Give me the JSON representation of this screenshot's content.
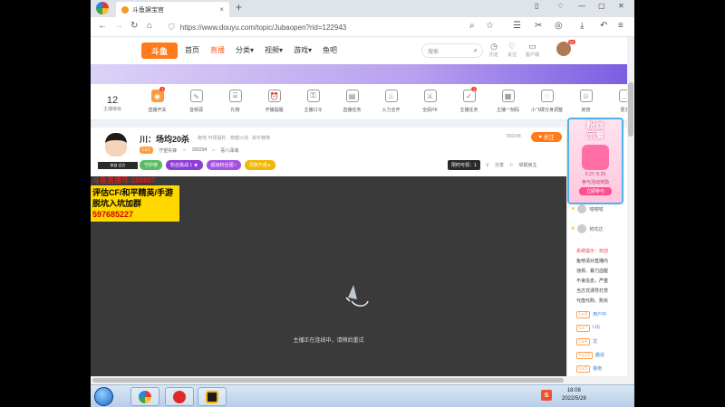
{
  "browser": {
    "tab_title": "斗鱼娱宝官",
    "url": "https://www.douyu.com/topic/Jubaopen?rid=122943"
  },
  "site": {
    "logo": "斗鱼",
    "nav": [
      "首页",
      "直播",
      "分类▾",
      "视频▾",
      "游戏▾",
      "鱼吧"
    ],
    "search_placeholder": "搜索",
    "header_icons": [
      "历史",
      "关注",
      "客户端"
    ],
    "avatar_badge": "99"
  },
  "funcbar": {
    "level": "12",
    "level_label": "主播等级",
    "items": [
      {
        "label": "直播开关",
        "icon": "broadcast-icon",
        "badge": "1"
      },
      {
        "label": "音频源",
        "icon": "audio-icon",
        "badge": ""
      },
      {
        "label": "礼物",
        "icon": "gift-icon",
        "badge": ""
      },
      {
        "label": "开播提醒",
        "icon": "alarm-icon",
        "badge": ""
      },
      {
        "label": "主播口令",
        "icon": "key-icon",
        "badge": ""
      },
      {
        "label": "直播任务",
        "icon": "task-icon",
        "badge": ""
      },
      {
        "label": "火力全开",
        "icon": "fire-icon",
        "badge": ""
      },
      {
        "label": "全民PK",
        "icon": "pk-icon",
        "badge": ""
      },
      {
        "label": "主播任务",
        "icon": "mission-icon",
        "badge": "1"
      },
      {
        "label": "主播一刻码",
        "icon": "code-icon",
        "badge": ""
      },
      {
        "label": "小飞碟分身调整",
        "icon": "ufo-icon",
        "badge": ""
      },
      {
        "label": "房管",
        "icon": "admin-icon",
        "badge": ""
      },
      {
        "label": "更多",
        "icon": "more-icon",
        "badge": ""
      }
    ]
  },
  "room": {
    "anchor_name": "来自 远方",
    "title": "川：场均20杀",
    "title_tags": "绝地 可领福利 · 穿越火线 · 和平精英",
    "category": "守望先锋",
    "level_pill": "Lv.1",
    "fans": "150294",
    "location": "喜八泽城",
    "followers": "780248",
    "follow_label": "关注",
    "badges": [
      {
        "text": "守护榜",
        "color": "#5bbb62"
      },
      {
        "text": "粉丝挑战 1 ★",
        "color": "#8b3dd6"
      },
      {
        "text": "超级粉丝团 ›",
        "color": "#a450e0"
      },
      {
        "text": "贵族开通 ▸",
        "color": "#f2b705"
      }
    ],
    "actions": {
      "limited": "限时可领：1",
      "share": "分享",
      "report": "举报房主"
    }
  },
  "player": {
    "promo_red_1": "斗鱼直播号:188887",
    "promo_yellow_1": "评估CF/和平精英/手游",
    "promo_yellow_2_prefix": "脱坑入坑加群",
    "promo_number": "597685227",
    "loading_text": "主播正在连线中，请稍后重试"
  },
  "rail": {
    "banner_title": "粉丝\n示爱",
    "banner_date": "5.27~5.29",
    "banner_sub": "参与活动奖励",
    "banner_btn": "立即参与",
    "viewers": [
      {
        "name": "喵喵喵"
      },
      {
        "name": "鲜花达"
      }
    ],
    "system_msgs": [
      {
        "text": "系统提示：欢迎",
        "red": true
      },
      {
        "text": "鱼吧请对直播内",
        "red": false
      },
      {
        "text": "违规、暴力血腥",
        "red": false
      },
      {
        "text": "不良信息，严重",
        "red": false
      },
      {
        "text": "当方式诱导打赏",
        "red": false
      },
      {
        "text": "代借代购、购买",
        "red": false
      }
    ],
    "chats": [
      {
        "level": "Lv.9",
        "name": "用户中"
      },
      {
        "level": "Lv.7",
        "name": "LDj"
      },
      {
        "level": "Lv.4",
        "name": "龙"
      },
      {
        "level": "Lv.12",
        "name": "趣说"
      },
      {
        "level": "Lv.5",
        "name": "鲁南"
      }
    ]
  },
  "taskbar": {
    "time": "18:08",
    "date": "2022/5/28",
    "ime": "S"
  }
}
